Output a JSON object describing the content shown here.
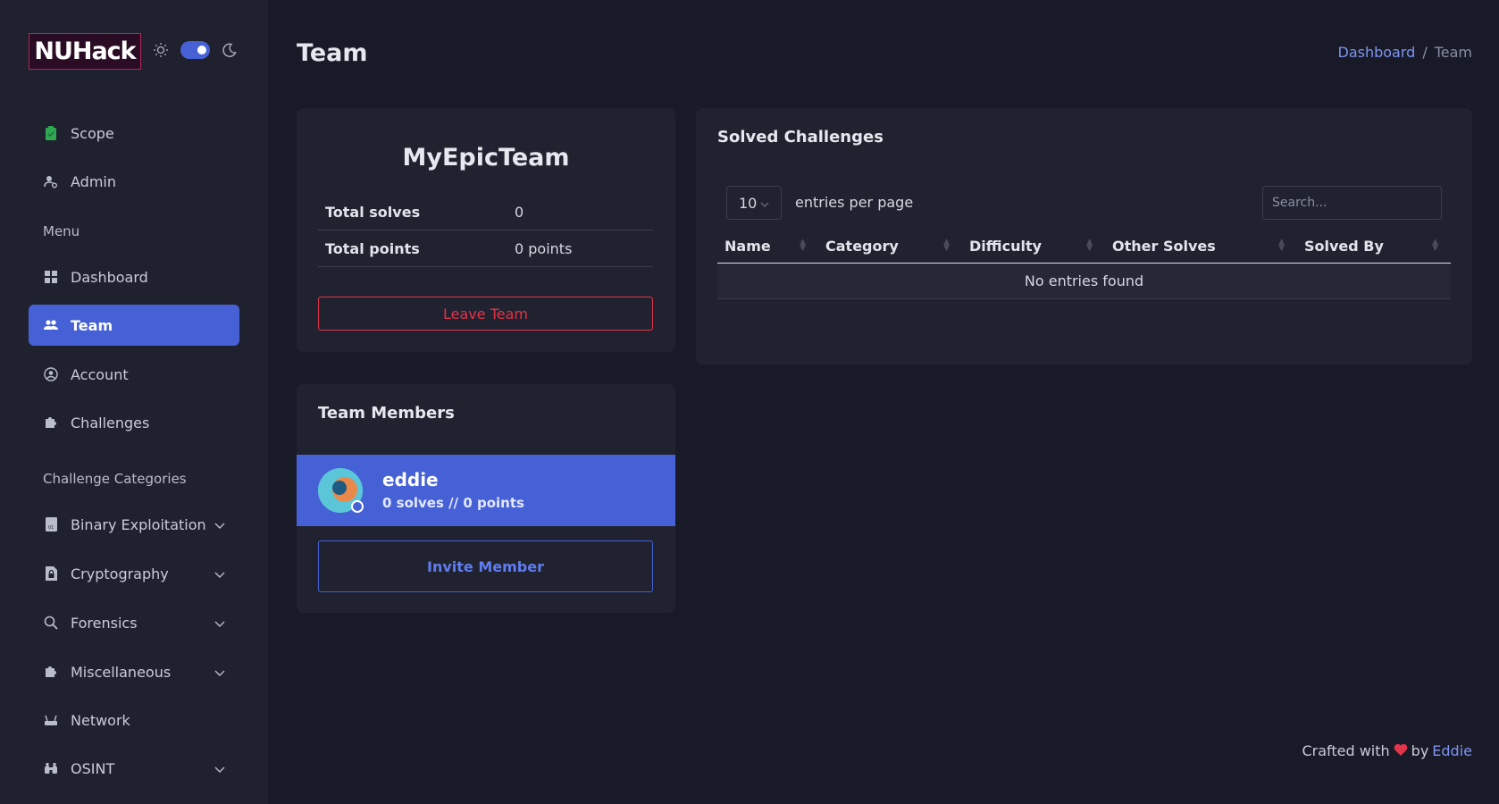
{
  "brand": {
    "logo_text": "NUHack",
    "accent": "#4661d6"
  },
  "theme_toggle": {
    "light_icon": "sun-icon",
    "dark_icon": "moon-icon",
    "state": "dark"
  },
  "sidebar": {
    "top_items": [
      {
        "label": "Scope",
        "icon": "clipboard-icon"
      },
      {
        "label": "Admin",
        "icon": "user-gear-icon"
      }
    ],
    "menu_label": "Menu",
    "menu_items": [
      {
        "label": "Dashboard",
        "icon": "grid-icon"
      },
      {
        "label": "Team",
        "icon": "users-icon",
        "active": true
      },
      {
        "label": "Account",
        "icon": "user-circle-icon"
      },
      {
        "label": "Challenges",
        "icon": "puzzle-icon"
      }
    ],
    "categories_label": "Challenge Categories",
    "categories": [
      {
        "label": "Binary Exploitation",
        "icon": "binary-file-icon",
        "expandable": true
      },
      {
        "label": "Cryptography",
        "icon": "lock-file-icon",
        "expandable": true
      },
      {
        "label": "Forensics",
        "icon": "search-icon",
        "expandable": true
      },
      {
        "label": "Miscellaneous",
        "icon": "puzzle-icon",
        "expandable": true
      },
      {
        "label": "Network",
        "icon": "network-icon",
        "expandable": false
      },
      {
        "label": "OSINT",
        "icon": "binoculars-icon",
        "expandable": true
      }
    ]
  },
  "header": {
    "title": "Team",
    "breadcrumb": {
      "home": "Dashboard",
      "separator": "/",
      "current": "Team"
    }
  },
  "team": {
    "name": "MyEpicTeam",
    "stats": [
      {
        "label": "Total solves",
        "value": "0"
      },
      {
        "label": "Total points",
        "value": "0 points"
      }
    ],
    "leave_button": "Leave Team"
  },
  "members": {
    "title": "Team Members",
    "list": [
      {
        "name": "eddie",
        "summary": "0 solves // 0 points"
      }
    ],
    "invite_button": "Invite Member"
  },
  "solved": {
    "title": "Solved Challenges",
    "entries_value": "10",
    "entries_label": "entries per page",
    "search_placeholder": "Search...",
    "columns": [
      "Name",
      "Category",
      "Difficulty",
      "Other Solves",
      "Solved By"
    ],
    "empty_text": "No entries found"
  },
  "footer": {
    "prefix": "Crafted with",
    "heart_icon": "heart-icon",
    "by": "by",
    "author": "Eddie"
  }
}
